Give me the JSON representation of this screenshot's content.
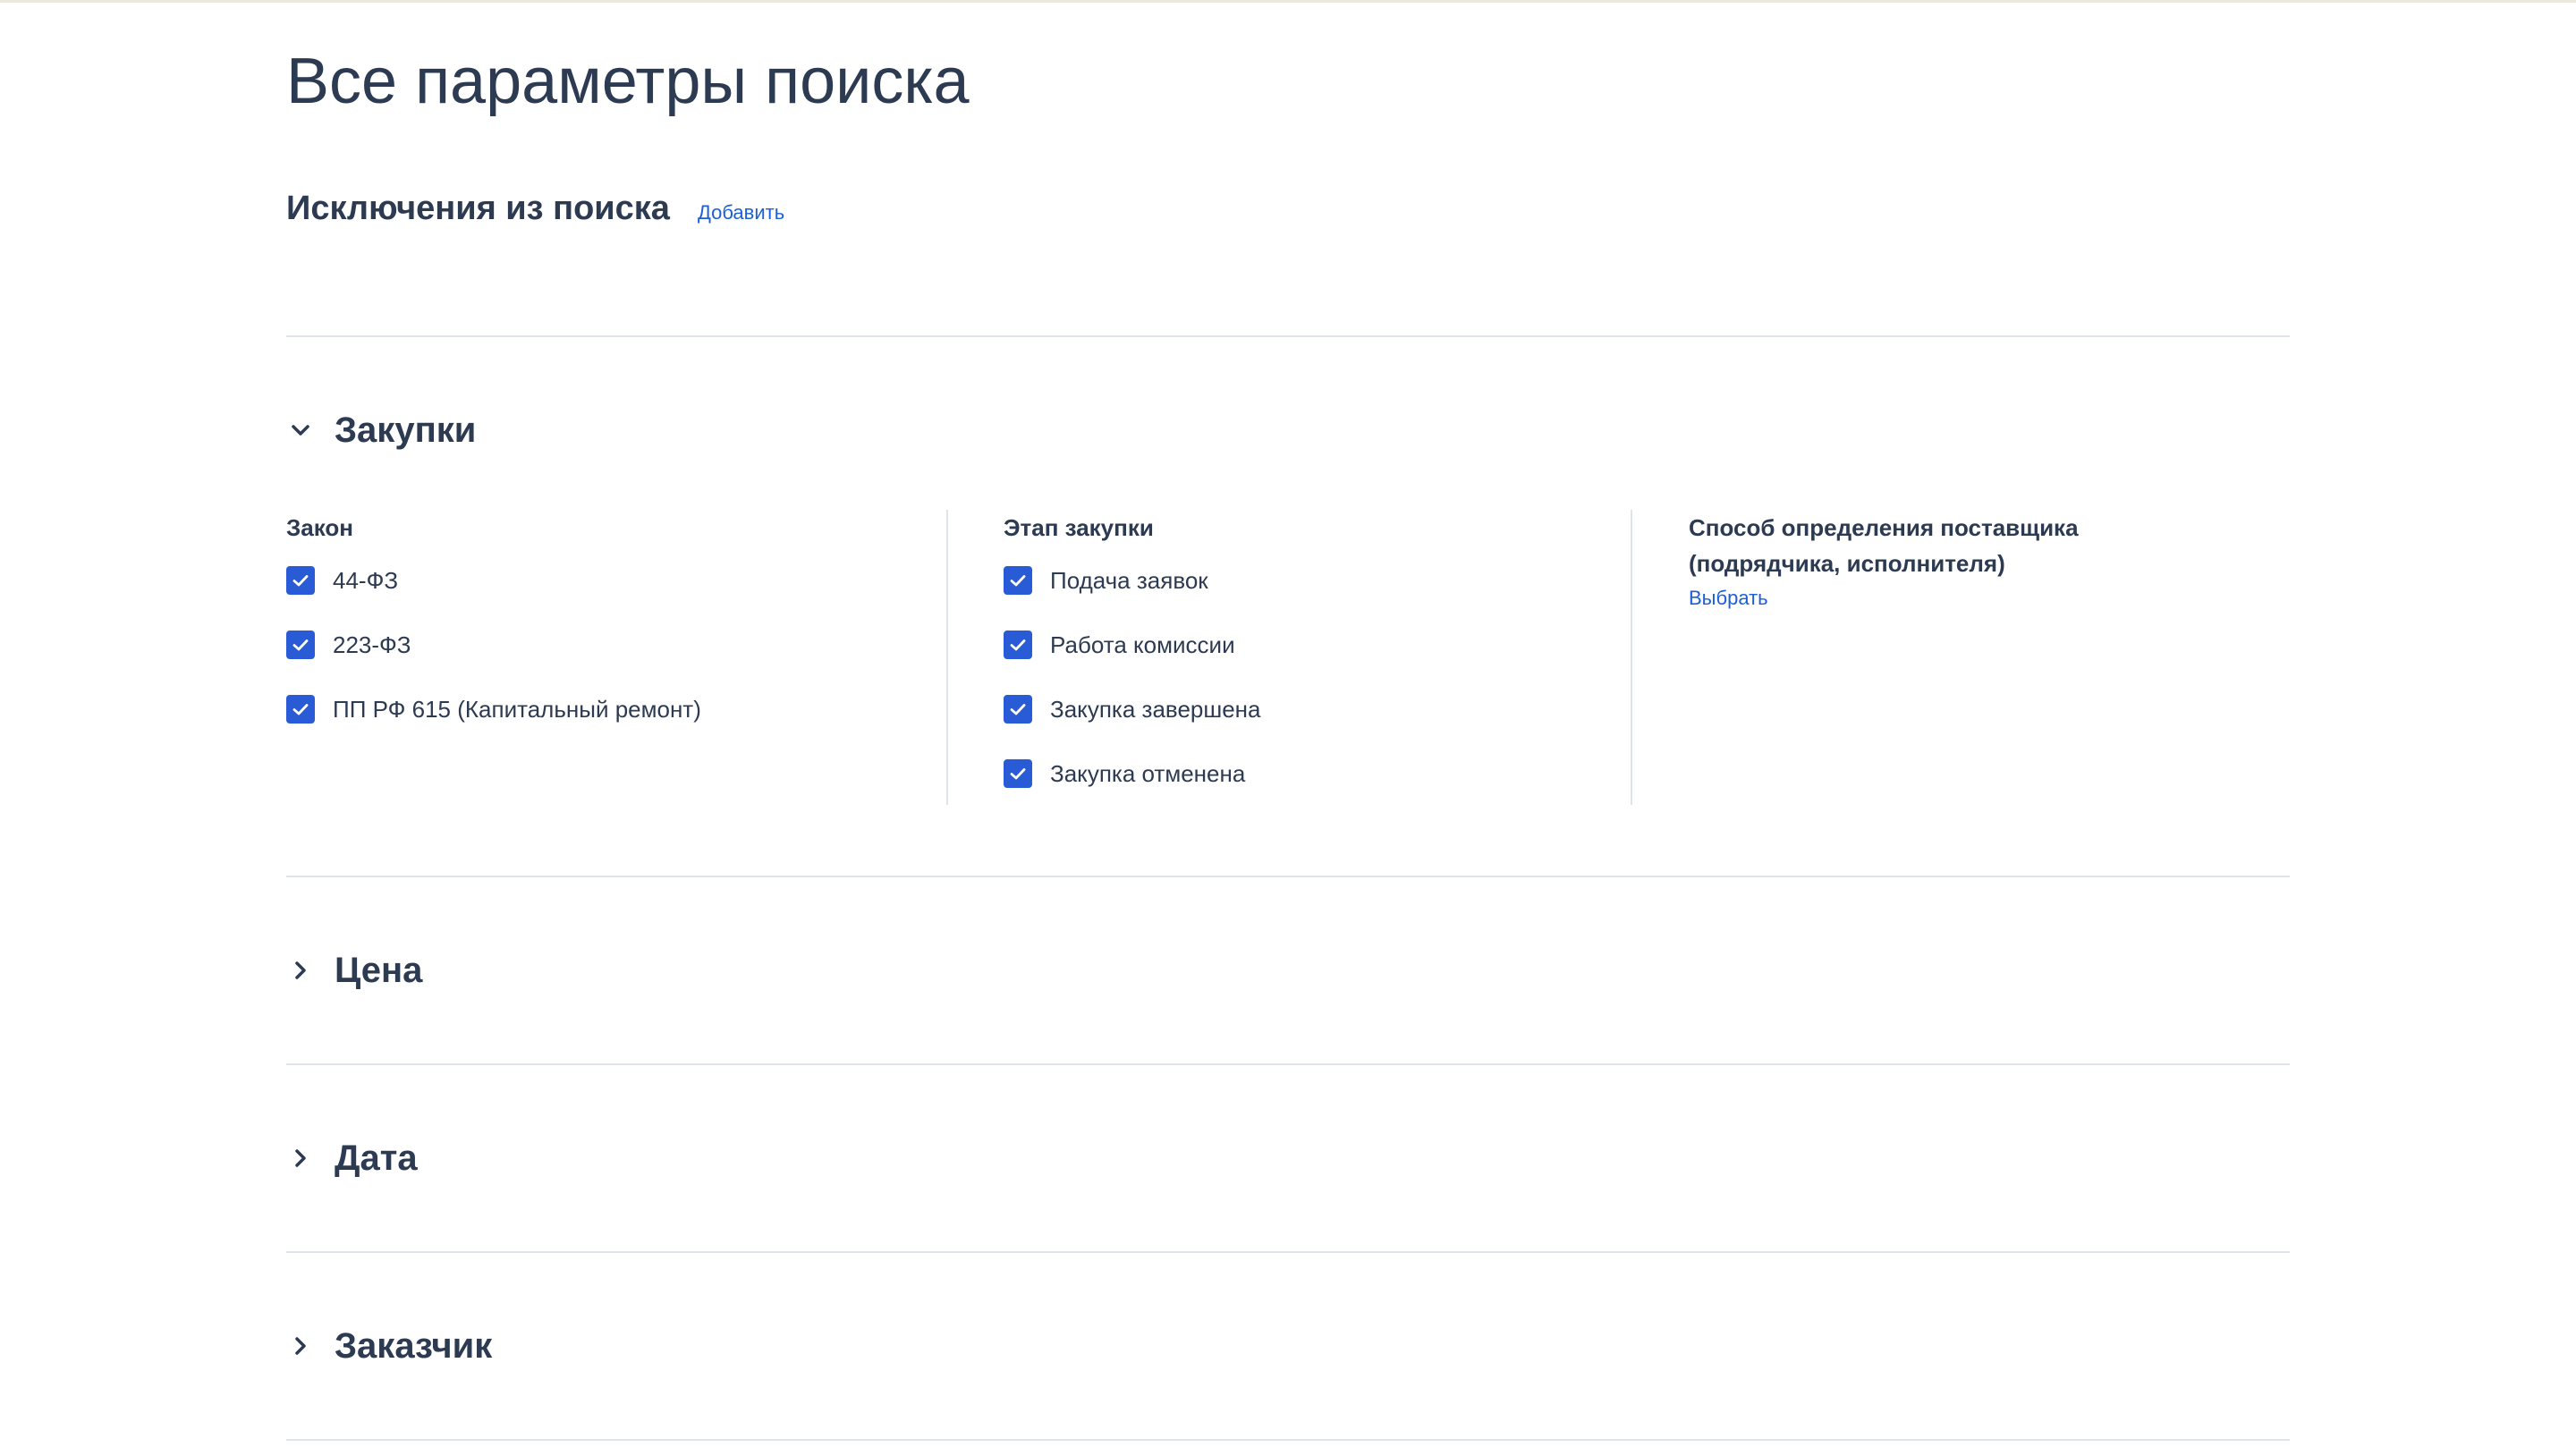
{
  "page": {
    "title": "Все параметры поиска"
  },
  "exclusions": {
    "title": "Исключения из поиска",
    "add_label": "Добавить"
  },
  "sections": {
    "purchases": {
      "title": "Закупки",
      "expanded": true,
      "columns": {
        "law": {
          "title": "Закон",
          "options": [
            {
              "label": "44-ФЗ",
              "checked": true
            },
            {
              "label": "223-ФЗ",
              "checked": true
            },
            {
              "label": "ПП РФ 615 (Капитальный ремонт)",
              "checked": true
            }
          ]
        },
        "stage": {
          "title": "Этап закупки",
          "options": [
            {
              "label": "Подача заявок",
              "checked": true
            },
            {
              "label": "Работа комиссии",
              "checked": true
            },
            {
              "label": "Закупка завершена",
              "checked": true
            },
            {
              "label": "Закупка отменена",
              "checked": true
            }
          ]
        },
        "method": {
          "title_line1": "Способ определения поставщика",
          "title_line2": "(подрядчика, исполнителя)",
          "select_label": "Выбрать"
        }
      }
    },
    "price": {
      "title": "Цена",
      "expanded": false
    },
    "date": {
      "title": "Дата",
      "expanded": false
    },
    "customer": {
      "title": "Заказчик",
      "expanded": false
    }
  },
  "colors": {
    "text": "#2c3a52",
    "link": "#1d5fd6",
    "checkbox": "#2a5bd7",
    "divider": "#dfe3ea"
  },
  "icons": {
    "expanded": "chevron-down-icon",
    "collapsed": "chevron-right-icon",
    "checkbox": "checkmark-icon"
  }
}
